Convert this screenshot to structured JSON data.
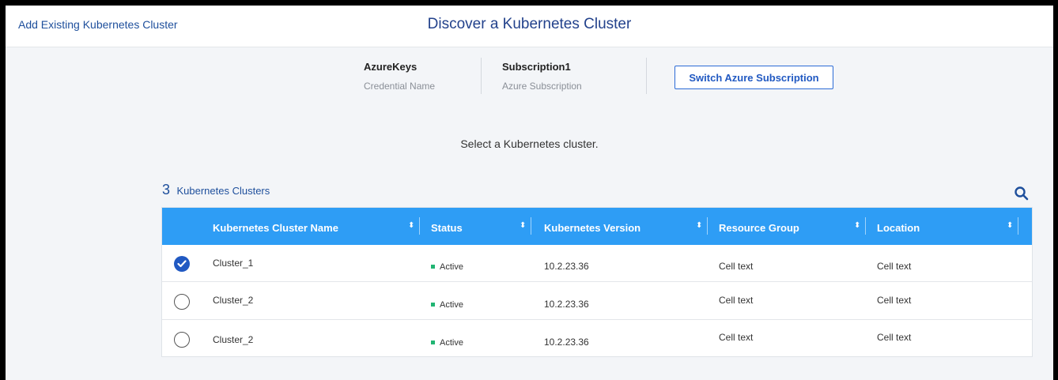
{
  "header": {
    "back_link": "Add Existing Kubernetes Cluster",
    "title": "Discover a Kubernetes Cluster"
  },
  "credentials": {
    "credential_value": "AzureKeys",
    "credential_label": "Credential Name",
    "subscription_value": "Subscription1",
    "subscription_label": "Azure Subscription",
    "switch_button": "Switch Azure Subscription"
  },
  "prompt": "Select a Kubernetes cluster.",
  "table": {
    "count": "3",
    "count_label": "Kubernetes Clusters",
    "columns": [
      "Kubernetes Cluster Name",
      "Status",
      "Kubernetes Version",
      "Resource Group",
      "Location"
    ],
    "rows": [
      {
        "selected": true,
        "name": "Cluster_1",
        "status": "Active",
        "version": "10.2.23.36",
        "resource_group": "Cell text",
        "location": "Cell text"
      },
      {
        "selected": false,
        "name": "Cluster_2",
        "status": "Active",
        "version": "10.2.23.36",
        "resource_group": "Cell text",
        "location": "Cell text"
      },
      {
        "selected": false,
        "name": "Cluster_2",
        "status": "Active",
        "version": "10.2.23.36",
        "resource_group": "Cell text",
        "location": "Cell text"
      }
    ]
  },
  "colors": {
    "header_bg": "#2e9df5",
    "accent": "#2159c2",
    "status_active": "#21b573"
  },
  "icons": {
    "search": "search-icon",
    "sort": "sort-icon",
    "check": "check-icon"
  }
}
